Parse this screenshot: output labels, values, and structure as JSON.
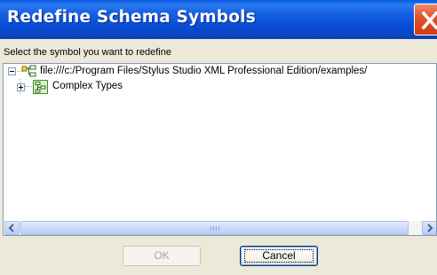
{
  "dialog": {
    "title": "Redefine Schema Symbols",
    "prompt": "Select the symbol you want to redefine"
  },
  "tree": {
    "items": [
      {
        "label": "file:///c:/Program Files/Stylus Studio XML Professional Edition/examples/",
        "expanded": true,
        "icon": "schema-icon"
      },
      {
        "label": "Complex Types",
        "expanded": false,
        "icon": "complex-types-icon"
      }
    ]
  },
  "scrollbar": {
    "left_arrow": "<",
    "right_arrow": ">"
  },
  "buttons": {
    "ok_label": "OK",
    "ok_enabled": false,
    "cancel_label": "Cancel"
  },
  "colors": {
    "titlebar": "#0a4fd8",
    "close_button": "#d33d12",
    "dialog_face": "#ece9d8",
    "tree_border": "#7f9db9"
  }
}
